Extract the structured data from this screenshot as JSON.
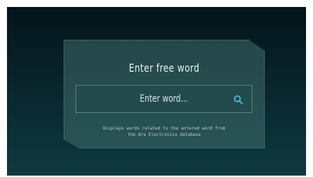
{
  "panel": {
    "title": "Enter free word",
    "search": {
      "placeholder": "Enter word...",
      "icon": "search-icon",
      "icon_color": "#4ab3c7"
    },
    "description_line1": "Displays words related to the entered word from",
    "description_line2": "the Ars Electronica database"
  },
  "colors": {
    "background_top": "#04141a",
    "background_bottom": "#0e3a40",
    "panel": "#406e6c",
    "text": "#e8f2f0"
  }
}
